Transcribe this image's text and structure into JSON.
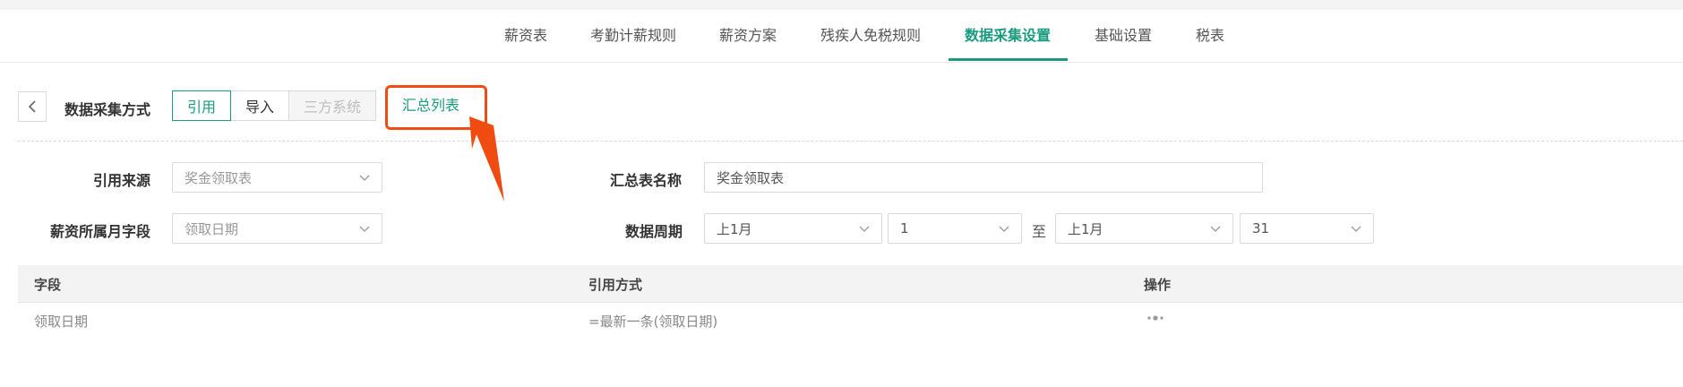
{
  "tabs": [
    {
      "label": "薪资表"
    },
    {
      "label": "考勤计薪规则"
    },
    {
      "label": "薪资方案"
    },
    {
      "label": "残疾人免税规则"
    },
    {
      "label": "数据采集设置",
      "active": true
    },
    {
      "label": "基础设置"
    },
    {
      "label": "税表"
    }
  ],
  "collect": {
    "label": "数据采集方式",
    "options": [
      "引用",
      "导入",
      "三方系统"
    ],
    "selected": "引用",
    "summary_link": "汇总列表"
  },
  "form": {
    "source_label": "引用来源",
    "source_placeholder": "奖金领取表",
    "month_field_label": "薪资所属月字段",
    "month_field_placeholder": "领取日期",
    "summary_name_label": "汇总表名称",
    "summary_name_value": "奖金领取表",
    "period_label": "数据周期",
    "period_start_month": "上1月",
    "period_start_day": "1",
    "period_to": "至",
    "period_end_month": "上1月",
    "period_end_day": "31"
  },
  "table": {
    "headers": [
      "字段",
      "引用方式",
      "操作"
    ],
    "rows": [
      {
        "field": "领取日期",
        "method": "=最新一条(领取日期)"
      }
    ]
  },
  "colors": {
    "accent": "#1a9b80",
    "highlight": "#f04c12"
  },
  "icons": {
    "back": "chevron-left-icon",
    "dropdown": "chevron-down-icon",
    "more": "more-dots-icon",
    "annotation": "arrow-annotation"
  }
}
